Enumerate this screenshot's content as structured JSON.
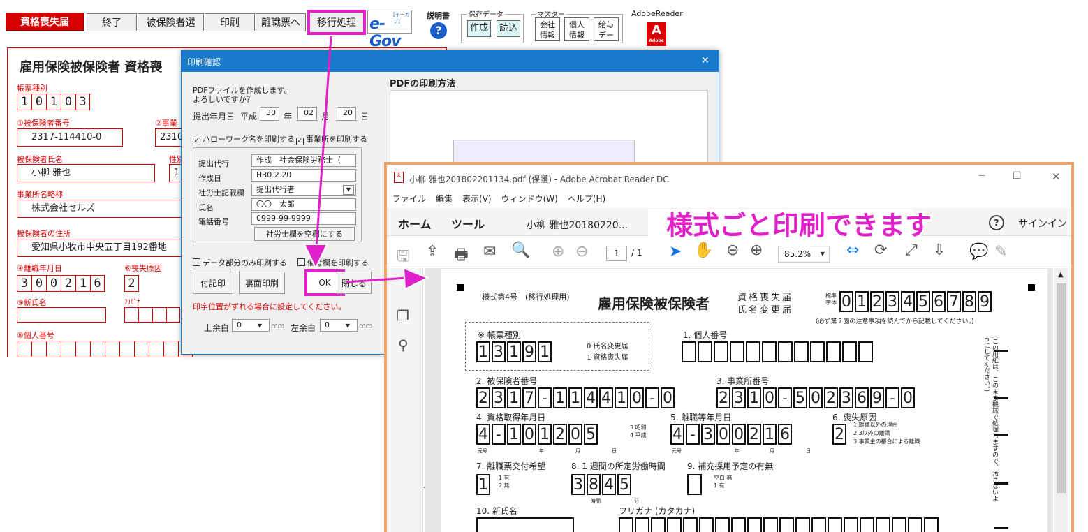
{
  "toolbar": {
    "tab_active": "資格喪失届",
    "end": "終了",
    "select_insured": "被保険者選",
    "print": "印刷",
    "to_separation": "離職票へ",
    "migration": "移行処理",
    "egov": "e-Gov",
    "egov_sub": "[イーガブ]",
    "manual": "説明書",
    "saved_data": "保存データ",
    "create": "作成",
    "load": "読込",
    "master": "マスター",
    "company_info": "会社\n情報",
    "personal_info": "個人\n情報",
    "salary_data": "給与\nデー",
    "adobe_reader": "AdobeReader",
    "adobe_small": "Adobe"
  },
  "form": {
    "title": "雇用保険被保険者 資格喪",
    "form_type_label": "帳票種別",
    "form_type_digits": [
      "1",
      "0",
      "1",
      "0",
      "3"
    ],
    "insured_no_label": "①被保険者番号",
    "insured_no": "2317-114410-0",
    "office_no_label": "②事業",
    "office_no_partial": "2310",
    "name_label": "被保険者氏名",
    "name": "小柳 雅也",
    "sex_label": "性別",
    "sex_partial": "1",
    "office_name_label": "事業所名略称",
    "office_name": "株式会社セルズ",
    "address_label": "被保険者の住所",
    "address": "愛知県小牧市中央五丁目192番地",
    "separation_date_label": "④離職年月日",
    "separation_date_digits": [
      "3",
      "0",
      "0",
      "2",
      "1",
      "6"
    ],
    "loss_reason_label": "⑥喪失原因",
    "loss_reason": "2",
    "new_name_label": "⑨新氏名",
    "furigana_label": "ﾌﾘｶﾞﾅ",
    "my_number_label": "⑩個人番号"
  },
  "dialog": {
    "title": "印刷確認",
    "close": "✕",
    "message": "PDFファイルを作成します。\nよろしいですか？",
    "date_label": "提出年月日",
    "era": "平成",
    "year": "30",
    "year_unit": "年",
    "month": "02",
    "month_unit": "月",
    "day": "20",
    "day_unit": "日",
    "hellowork_check": "ハローワーク名を印刷する",
    "office_check": "事業所を印刷する",
    "agent_label": "提出代行",
    "agent_value": "作成　社会保険労務士（",
    "created_label": "作成日",
    "created_value": "H30.2.20",
    "sharoushi_label": "社労士記載欄",
    "sharoushi_value": "提出代行者",
    "fullname_label": "氏名",
    "fullname_value": "〇〇　太郎",
    "phone_label": "電話番号",
    "phone_value": "0999-99-9999",
    "blank_btn": "社労士欄を空欄にする",
    "data_only_check": "データ部分のみ印刷する",
    "remarks_check": "備考欄を印刷する",
    "attach_print": "付記印",
    "back_print": "裏面印刷",
    "ok": "OK",
    "close_btn": "閉じる",
    "warning": "印字位置がずれる場合に設定してください。",
    "top_margin_label": "上余白",
    "top_margin": "0",
    "left_margin_label": "左余白",
    "left_margin": "0",
    "mm": "mm",
    "pdf_section_title": "PDFの印刷方法"
  },
  "acrobat": {
    "title": "小柳 雅也201802201134.pdf (保護) - Adobe Acrobat Reader DC",
    "menu": [
      "ファイル",
      "編集",
      "表示(V)",
      "ウィンドウ(W)",
      "ヘルプ(H)"
    ],
    "tab_home": "ホーム",
    "tab_tools": "ツール",
    "tab_doc": "小柳 雅也20180220...",
    "signin": "サインイン",
    "page_current": "1",
    "page_total": "/ 1",
    "zoom": "85.2%",
    "callout": "様式ごと印刷できます"
  },
  "pdf": {
    "form_no": "様式第4号　(移行処理用)",
    "title": "雇用保険被保険者",
    "title2a": "資格喪失届",
    "title2b": "氏名変更届",
    "std_font_label": "標準\n字体",
    "std_font_digits": [
      "0",
      "1",
      "2",
      "3",
      "4",
      "5",
      "6",
      "7",
      "8",
      "9"
    ],
    "note": "(必ず第２面の注意事項を読んでから記載してください。)",
    "form_type_label": "※ 帳票種別",
    "form_type_digits": [
      "1",
      "3",
      "1",
      "9",
      "1"
    ],
    "form_type_opt1": "0 氏名変更届",
    "form_type_opt2": "1 資格喪失届",
    "my_number_label": "1. 個人番号",
    "insured_no_label": "2. 被保険者番号",
    "insured_no": [
      "2",
      "3",
      "1",
      "7",
      "-",
      "1",
      "1",
      "4",
      "4",
      "1",
      "0",
      "-",
      "0"
    ],
    "office_no_label": "3. 事業所番号",
    "office_no": [
      "2",
      "3",
      "1",
      "0",
      "-",
      "5",
      "0",
      "2",
      "3",
      "6",
      "9",
      "-",
      "0"
    ],
    "acq_date_label": "4. 資格取得年月日",
    "acq_date": [
      "4",
      "-",
      "1",
      "0",
      "1",
      "2",
      "0",
      "5"
    ],
    "era_opts": "3 昭和\n4 平成",
    "sep_date_label": "5. 離職等年月日",
    "sep_date": [
      "4",
      "-",
      "3",
      "0",
      "0",
      "2",
      "1",
      "6"
    ],
    "loss_reason_label": "6. 喪失原因",
    "loss_reason": "2",
    "loss_opts": [
      "1 離職以外の理由",
      "2 3以外の離職",
      "3 事業主の都合による離職"
    ],
    "era_label": "元号",
    "year": "年",
    "month": "月",
    "day": "日",
    "hope_label": "7. 離職票交付希望",
    "hope_value": "1",
    "hope_opts": "1 有\n2 無",
    "weekly_hours_label": "8. 1 週間の所定労働時間",
    "weekly_hours": [
      "3",
      "8",
      "4",
      "5"
    ],
    "hours_unit": "時間",
    "minutes_unit": "分",
    "rehire_label": "9. 補充採用予定の有無",
    "rehire_opts": "空白 無\n1 有",
    "new_name_label": "10. 新氏名",
    "furigana_label": "フリガナ (カタカナ)",
    "side_note": "(この用紙は、このまま機械で処理しますので、汚さないようにしてください。)"
  },
  "colors": {
    "red": "#d40000",
    "magenta": "#e020c8",
    "dialog_title": "#1979ca",
    "acrobat_frame": "#f0a46a"
  }
}
